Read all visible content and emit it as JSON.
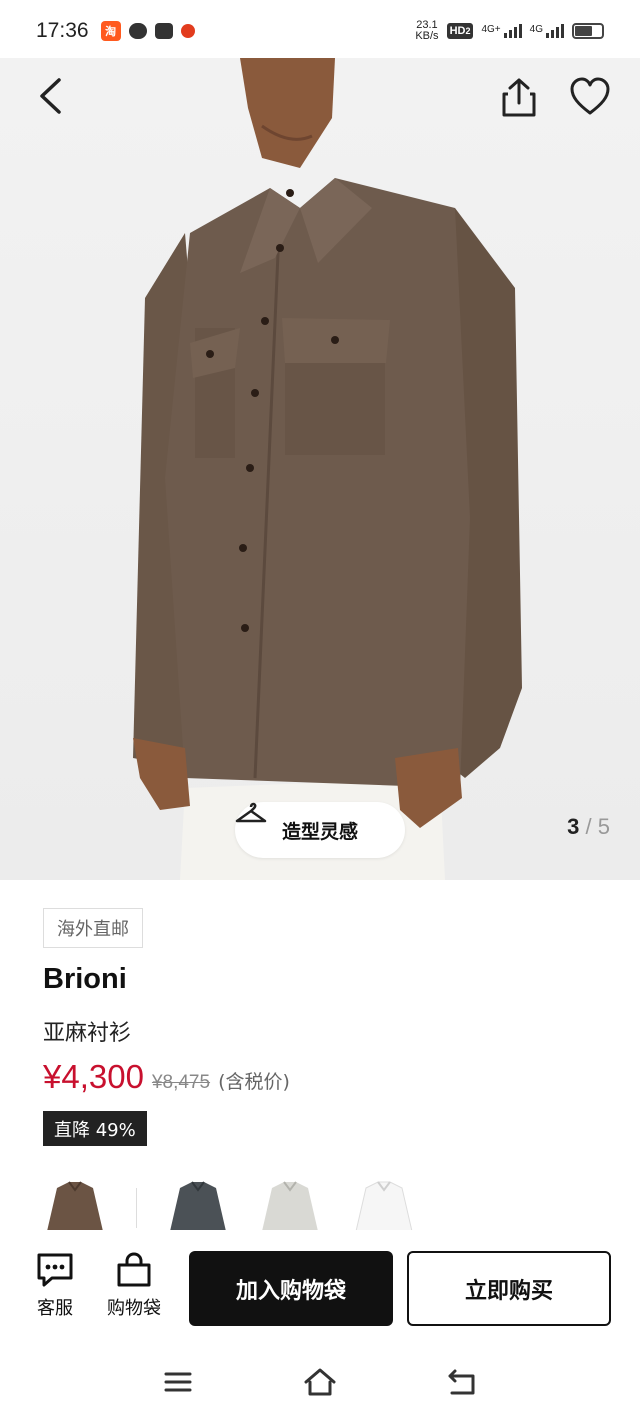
{
  "status_bar": {
    "time": "17:36",
    "taobao_glyph": "淘",
    "net_speed_value": "23.1",
    "net_speed_unit": "KB/s",
    "hd_label": "HD",
    "hd_sub": "2",
    "signal1_label": "4G+",
    "signal2_label": "4G"
  },
  "hero": {
    "style_button_label": "造型灵感",
    "pager_current": "3",
    "pager_separator": "/",
    "pager_total": "5"
  },
  "product": {
    "tag": "海外直邮",
    "brand": "Brioni",
    "name": "亚麻衬衫",
    "price": "¥4,300",
    "original_price": "¥8,475",
    "tax_note": "(含税价)",
    "discount": "直降 49%"
  },
  "thumbnails": [
    {
      "color": "#6b5444",
      "icon": "brown-shirt"
    },
    {
      "color": "#4b5156",
      "icon": "slate-shirt"
    },
    {
      "color": "#d9d9d4",
      "icon": "stone-shirt"
    },
    {
      "color": "#f6f6f6",
      "icon": "white-shirt"
    }
  ],
  "actions": {
    "service_label": "客服",
    "bag_label": "购物袋",
    "add_to_bag": "加入购物袋",
    "buy_now": "立即购买"
  },
  "colors": {
    "price": "#c8102e",
    "primary_button": "#111111",
    "shirt": "#6e5b4d"
  }
}
